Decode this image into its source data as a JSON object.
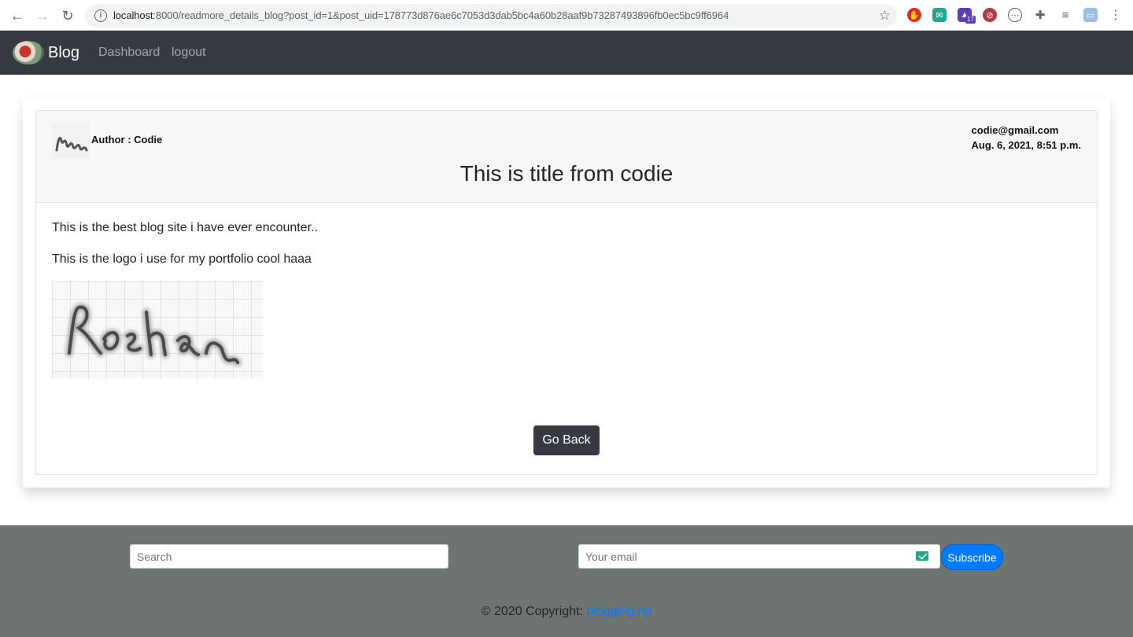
{
  "browser": {
    "url_host": "localhost",
    "url_rest": ":8000/readmore_details_blog?post_id=1&post_uid=178773d876ae6c7053d3dab5bc4a60b28aaf9b73287493896fb0ec5bc9ff6964",
    "extension_badge": "17"
  },
  "navbar": {
    "brand": "Blog",
    "links": [
      "Dashboard",
      "logout"
    ]
  },
  "post": {
    "author": "Author : Codie",
    "email": "codie@gmail.com",
    "date": "Aug. 6, 2021, 8:51 p.m.",
    "title": "This is title from codie",
    "paragraphs": [
      "This is the best blog site i have ever encounter..",
      "This is the logo i use for my portfolio cool haaa"
    ],
    "image_text": "Roshan",
    "go_back": "Go Back"
  },
  "footer": {
    "search_placeholder": "Search",
    "email_placeholder": "Your email",
    "subscribe": "Subscribe",
    "copyright_prefix": "© 2020 Copyright: ",
    "copyright_link": "blogging.np"
  },
  "colors": {
    "navbar_bg": "#343a40",
    "footer_bg": "#6e7570",
    "primary": "#007bff"
  }
}
